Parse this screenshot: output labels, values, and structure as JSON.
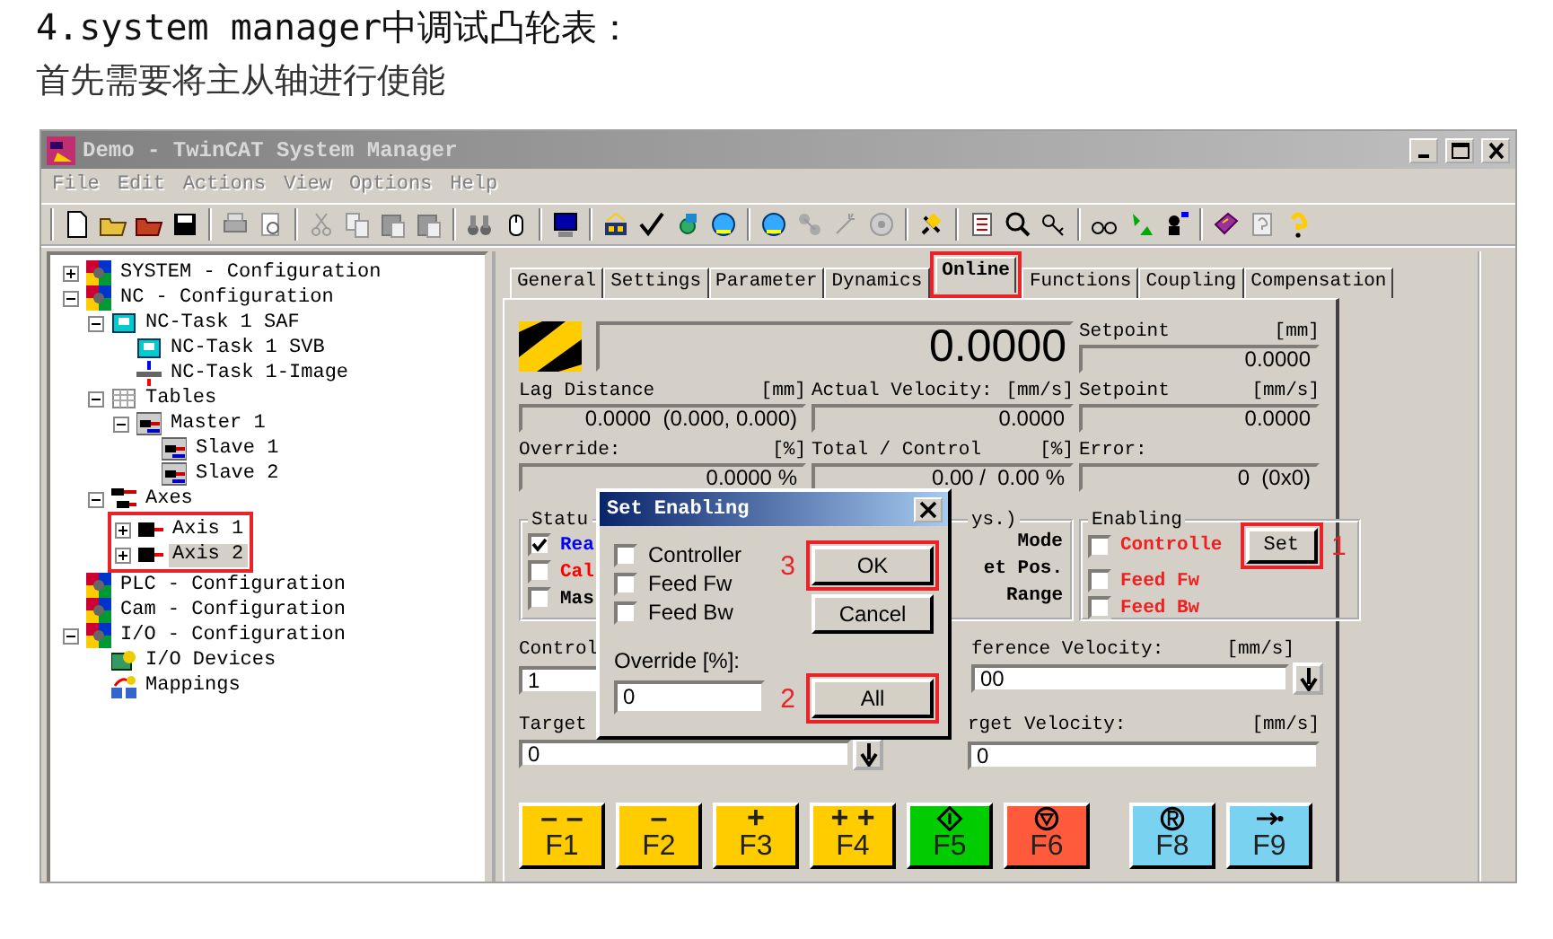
{
  "document": {
    "heading": "4.system manager中调试凸轮表：",
    "intro": "首先需要将主从轴进行使能"
  },
  "window": {
    "title": "Demo - TwinCAT System Manager",
    "active": false
  },
  "menu": [
    "File",
    "Edit",
    "Actions",
    "View",
    "Options",
    "Help"
  ],
  "tree": [
    {
      "label": "SYSTEM - Configuration",
      "kind": "config",
      "expanded": false,
      "selected": false
    },
    {
      "label": "NC - Configuration",
      "kind": "config",
      "expanded": true,
      "selected": false,
      "children": [
        {
          "label": "NC-Task 1 SAF",
          "kind": "task",
          "expanded": true,
          "selected": false,
          "children": [
            {
              "label": "NC-Task 1 SVB",
              "kind": "task",
              "selected": false
            },
            {
              "label": "NC-Task 1-Image",
              "kind": "image",
              "selected": false
            }
          ]
        },
        {
          "label": "Tables",
          "kind": "table",
          "expanded": true,
          "selected": false,
          "children": [
            {
              "label": "Master 1",
              "kind": "cam",
              "expanded": true,
              "selected": false,
              "children": [
                {
                  "label": "Slave 1",
                  "kind": "cam",
                  "selected": false
                },
                {
                  "label": "Slave 2",
                  "kind": "cam",
                  "selected": false
                }
              ]
            }
          ]
        },
        {
          "label": "Axes",
          "kind": "axes",
          "expanded": true,
          "selected": false,
          "children_highlighted": true,
          "children": [
            {
              "label": "Axis 1",
              "kind": "axis",
              "expanded": false,
              "selected": false
            },
            {
              "label": "Axis 2",
              "kind": "axis",
              "expanded": false,
              "selected": true
            }
          ]
        }
      ]
    },
    {
      "label": "PLC - Configuration",
      "kind": "config",
      "selected": false
    },
    {
      "label": "Cam - Configuration",
      "kind": "config",
      "selected": false
    },
    {
      "label": "I/O - Configuration",
      "kind": "config",
      "expanded": true,
      "selected": false,
      "children": [
        {
          "label": "I/O Devices",
          "kind": "devices",
          "selected": false
        },
        {
          "label": "Mappings",
          "kind": "mappings",
          "selected": false
        }
      ]
    }
  ],
  "tabs": [
    {
      "label": "General",
      "selected": false,
      "highlighted": false
    },
    {
      "label": "Settings",
      "selected": false,
      "highlighted": false
    },
    {
      "label": "Parameter",
      "selected": false,
      "highlighted": false
    },
    {
      "label": "Dynamics",
      "selected": false,
      "highlighted": false
    },
    {
      "label": "Online",
      "selected": true,
      "highlighted": true
    },
    {
      "label": "Functions",
      "selected": false,
      "highlighted": false
    },
    {
      "label": "Coupling",
      "selected": false,
      "highlighted": false
    },
    {
      "label": "Compensation",
      "selected": false,
      "highlighted": false
    }
  ],
  "online": {
    "position_value": "0.0000",
    "setpoint_position": {
      "label": "Setpoint",
      "unit": "[mm]",
      "value": "0.0000"
    },
    "lag_distance": {
      "label": "Lag Distance",
      "unit": "[mm]",
      "value": "0.0000  (0.000, 0.000)"
    },
    "actual_velocity": {
      "label": "Actual Velocity:",
      "unit": "[mm/s]",
      "value": "0.0000"
    },
    "setpoint_velocity": {
      "label": "Setpoint",
      "unit": "[mm/s]",
      "value": "0.0000"
    },
    "override": {
      "label": "Override:",
      "unit": "[%]",
      "value": "0.0000 %"
    },
    "total_control": {
      "label": "Total / Control",
      "unit": "[%]",
      "value": "0.00 /  0.00 %"
    },
    "error": {
      "label": "Error:",
      "value": "0  (0x0)"
    },
    "status": {
      "legend": "Statu",
      "items": [
        {
          "label": "Rea",
          "checked": true,
          "color": "#0000ff"
        },
        {
          "label": "Cal",
          "checked": false,
          "color": "#ff0000"
        },
        {
          "label": "Mas",
          "checked": false,
          "color": "#000000"
        }
      ]
    },
    "status_2": {
      "legend": "ys.)",
      "items": [
        "Mode",
        "et Pos.",
        "Range"
      ]
    },
    "enabling": {
      "legend": "Enabling",
      "items": [
        {
          "label": "Controlle",
          "checked": false
        },
        {
          "label": "Feed Fw",
          "checked": false
        },
        {
          "label": "Feed Bw",
          "checked": false
        }
      ],
      "button": {
        "label": "Set",
        "highlighted": true,
        "step": "1"
      }
    },
    "control": {
      "label": "Control",
      "value": "1"
    },
    "reference_velocity": {
      "label": "ference Velocity:",
      "unit": "[mm/s]",
      "value": "00"
    },
    "target": {
      "label": "Target",
      "value": "0"
    },
    "target_velocity": {
      "label": "rget Velocity:",
      "unit": "[mm/s]",
      "value": "0"
    },
    "function_keys": [
      {
        "kind": "text",
        "symbol": "– –",
        "label": "F1",
        "color": "#ffcc00"
      },
      {
        "kind": "text",
        "symbol": "–",
        "label": "F2",
        "color": "#ffcc00"
      },
      {
        "kind": "text",
        "symbol": "+",
        "label": "F3",
        "color": "#ffcc00"
      },
      {
        "kind": "text",
        "symbol": "+ +",
        "label": "F4",
        "color": "#ffcc00"
      },
      {
        "kind": "start",
        "label": "F5",
        "color": "#00cc00"
      },
      {
        "kind": "stop",
        "label": "F6",
        "color": "#ff5a3c"
      },
      {
        "kind": "reset",
        "label": "F8",
        "color": "#78d2f0"
      },
      {
        "kind": "home",
        "label": "F9",
        "color": "#78d2f0"
      }
    ]
  },
  "dialog": {
    "title": "Set Enabling",
    "checks": [
      {
        "label": "Controller",
        "checked": false
      },
      {
        "label": "Feed Fw",
        "checked": false
      },
      {
        "label": "Feed Bw",
        "checked": false
      }
    ],
    "override_label": "Override [%]:",
    "override_value": "0",
    "buttons": [
      {
        "label": "OK",
        "highlighted": true,
        "step": "3"
      },
      {
        "label": "Cancel",
        "highlighted": false
      },
      {
        "label": "All",
        "highlighted": true,
        "step": "2"
      }
    ]
  }
}
